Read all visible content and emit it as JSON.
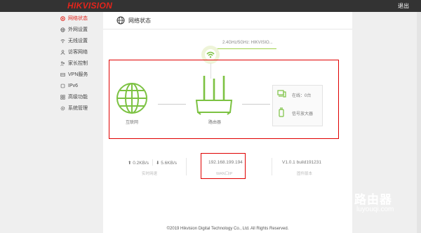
{
  "header": {
    "logo": "HIKVISION",
    "logout": "退出"
  },
  "sidebar": {
    "items": [
      {
        "label": "网络状态",
        "icon": "status-icon",
        "active": true
      },
      {
        "label": "外网设置",
        "icon": "globe-icon"
      },
      {
        "label": "无线设置",
        "icon": "wifi-icon"
      },
      {
        "label": "访客网络",
        "icon": "guest-icon"
      },
      {
        "label": "家长控制",
        "icon": "parent-control-icon"
      },
      {
        "label": "VPN服务",
        "icon": "vpn-icon"
      },
      {
        "label": "IPv6",
        "icon": "ipv6-icon"
      },
      {
        "label": "高级功能",
        "icon": "advanced-icon"
      },
      {
        "label": "系统管理",
        "icon": "system-icon"
      }
    ]
  },
  "main": {
    "title": "网络状态",
    "ssid": "2.4GHz/5GHz: HIKVISIO...",
    "internet_label": "互联网",
    "router_label": "路由器",
    "online_devices": "在线：0台",
    "repeater_label": "信号放大器",
    "upload_speed": "0.2KB/s",
    "download_speed": "5.6KB/s",
    "speed_caption": "实时网速",
    "wan_ip": "192.168.199.194",
    "wan_caption": "WAN口IP",
    "firmware": "V1.0.1 build191231",
    "firmware_caption": "固件版本"
  },
  "footer": "©2019 Hikvision Digital Technology Co., Ltd. All Rights Reserved.",
  "watermark": {
    "title": "路由器",
    "subtitle": "luyouqi.com"
  },
  "colors": {
    "accent_green": "#7cc242",
    "brand_red": "#e3241b",
    "highlight_red": "#e00000"
  }
}
